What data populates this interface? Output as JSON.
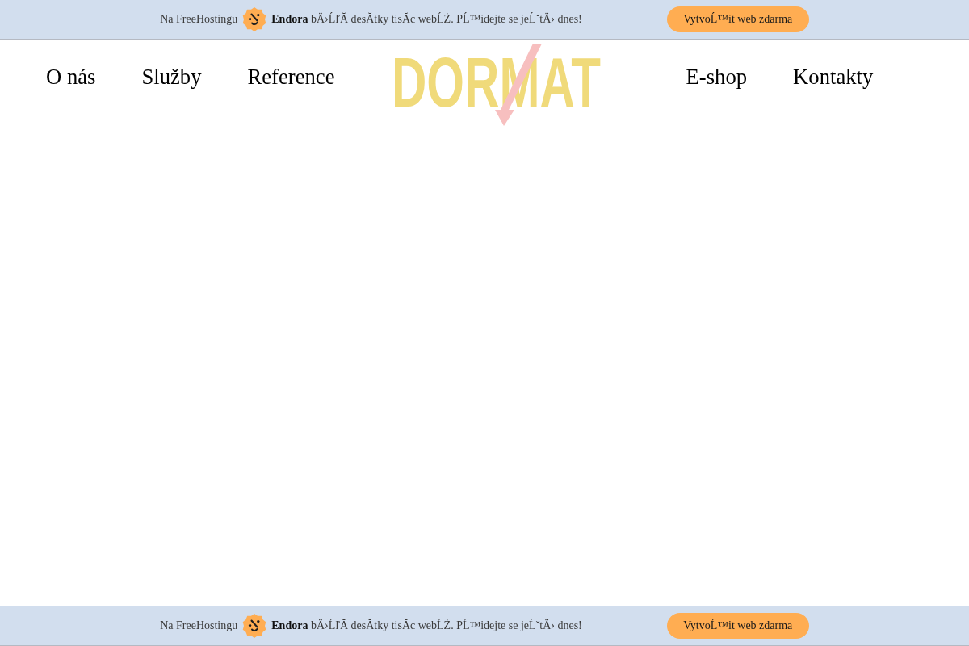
{
  "top_banner": {
    "lead": "Na FreeHostingu",
    "message": "**Endora** bÄ›ĹľĂ desĂtky tisĂc webĹŻ. PĹ™idejte se jeĹˇtÄ› dnes!",
    "button": "VytvoĹ™it web zdarma"
  },
  "navigation": {
    "left_links": [
      "O nás",
      "Služby",
      "Reference"
    ],
    "logo": {
      "text": "DORMAT"
    },
    "right_links": [
      "E-shop",
      "Kontakty"
    ]
  },
  "bottom_banner": {
    "lead": "Na FreeHostingu",
    "message": "**Endora** bÄ›ĹľĂ desĂtky tisĂc webĹŻ. PĹ™idejte se jeĹˇtÄ› dnes!",
    "button": "VytvoĹ™it web zdarma"
  }
}
